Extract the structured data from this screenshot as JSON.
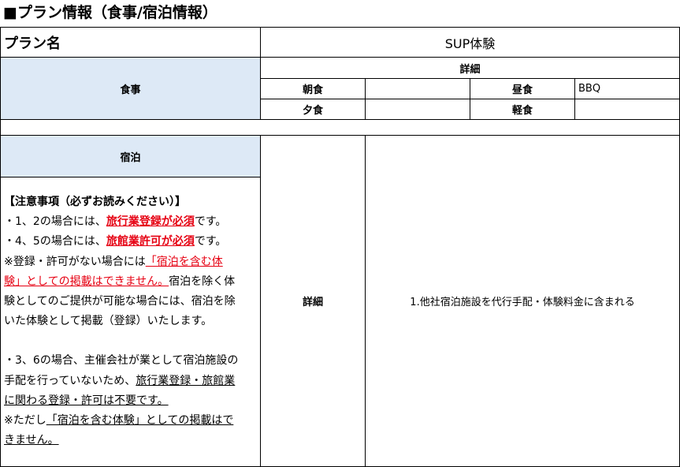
{
  "title": "■プラン情報（食事/宿泊情報）",
  "plan": {
    "label": "プラン名",
    "value": "SUP体験"
  },
  "meal": {
    "label": "食事",
    "detail_header": "詳細",
    "breakfast_label": "朝食",
    "breakfast_value": "",
    "lunch_label": "昼食",
    "lunch_value": "BBQ",
    "dinner_label": "夕食",
    "dinner_value": "",
    "snack_label": "軽食",
    "snack_value": ""
  },
  "stay": {
    "label": "宿泊",
    "detail_label": "詳細",
    "detail_value": "1.他社宿泊施設を代行手配・体験料金に含まれる",
    "notes": {
      "heading": "【注意事項（必ずお読みください）】",
      "l1_a": "・1、2の場合には、",
      "l1_b": "旅行業登録が必須",
      "l1_c": "です。",
      "l2_a": "・4、5の場合には、",
      "l2_b": "旅館業許可が必須",
      "l2_c": "です。",
      "l3_a": "※登録・許可がない場合には",
      "l3_b": "「宿泊を含む体",
      "l4_a": "験」としての掲載はできません。",
      "l4_b": "宿泊を除く体",
      "l5": "験としてのご提供が可能な場合には、宿泊を除",
      "l6": "いた体験として掲載（登録）いたします。",
      "l7": "・3、6の場合、主催会社が業として宿泊施設の",
      "l8_a": "手配を行っていないため、",
      "l8_b": "旅行業登録・旅館業",
      "l9_a": "に関わる登録・許可は",
      "l9_b": "不要です。",
      "l10_a": "※ただし",
      "l10_b": "「宿泊を含む体験」としての掲載はで",
      "l11": "きません。"
    }
  }
}
